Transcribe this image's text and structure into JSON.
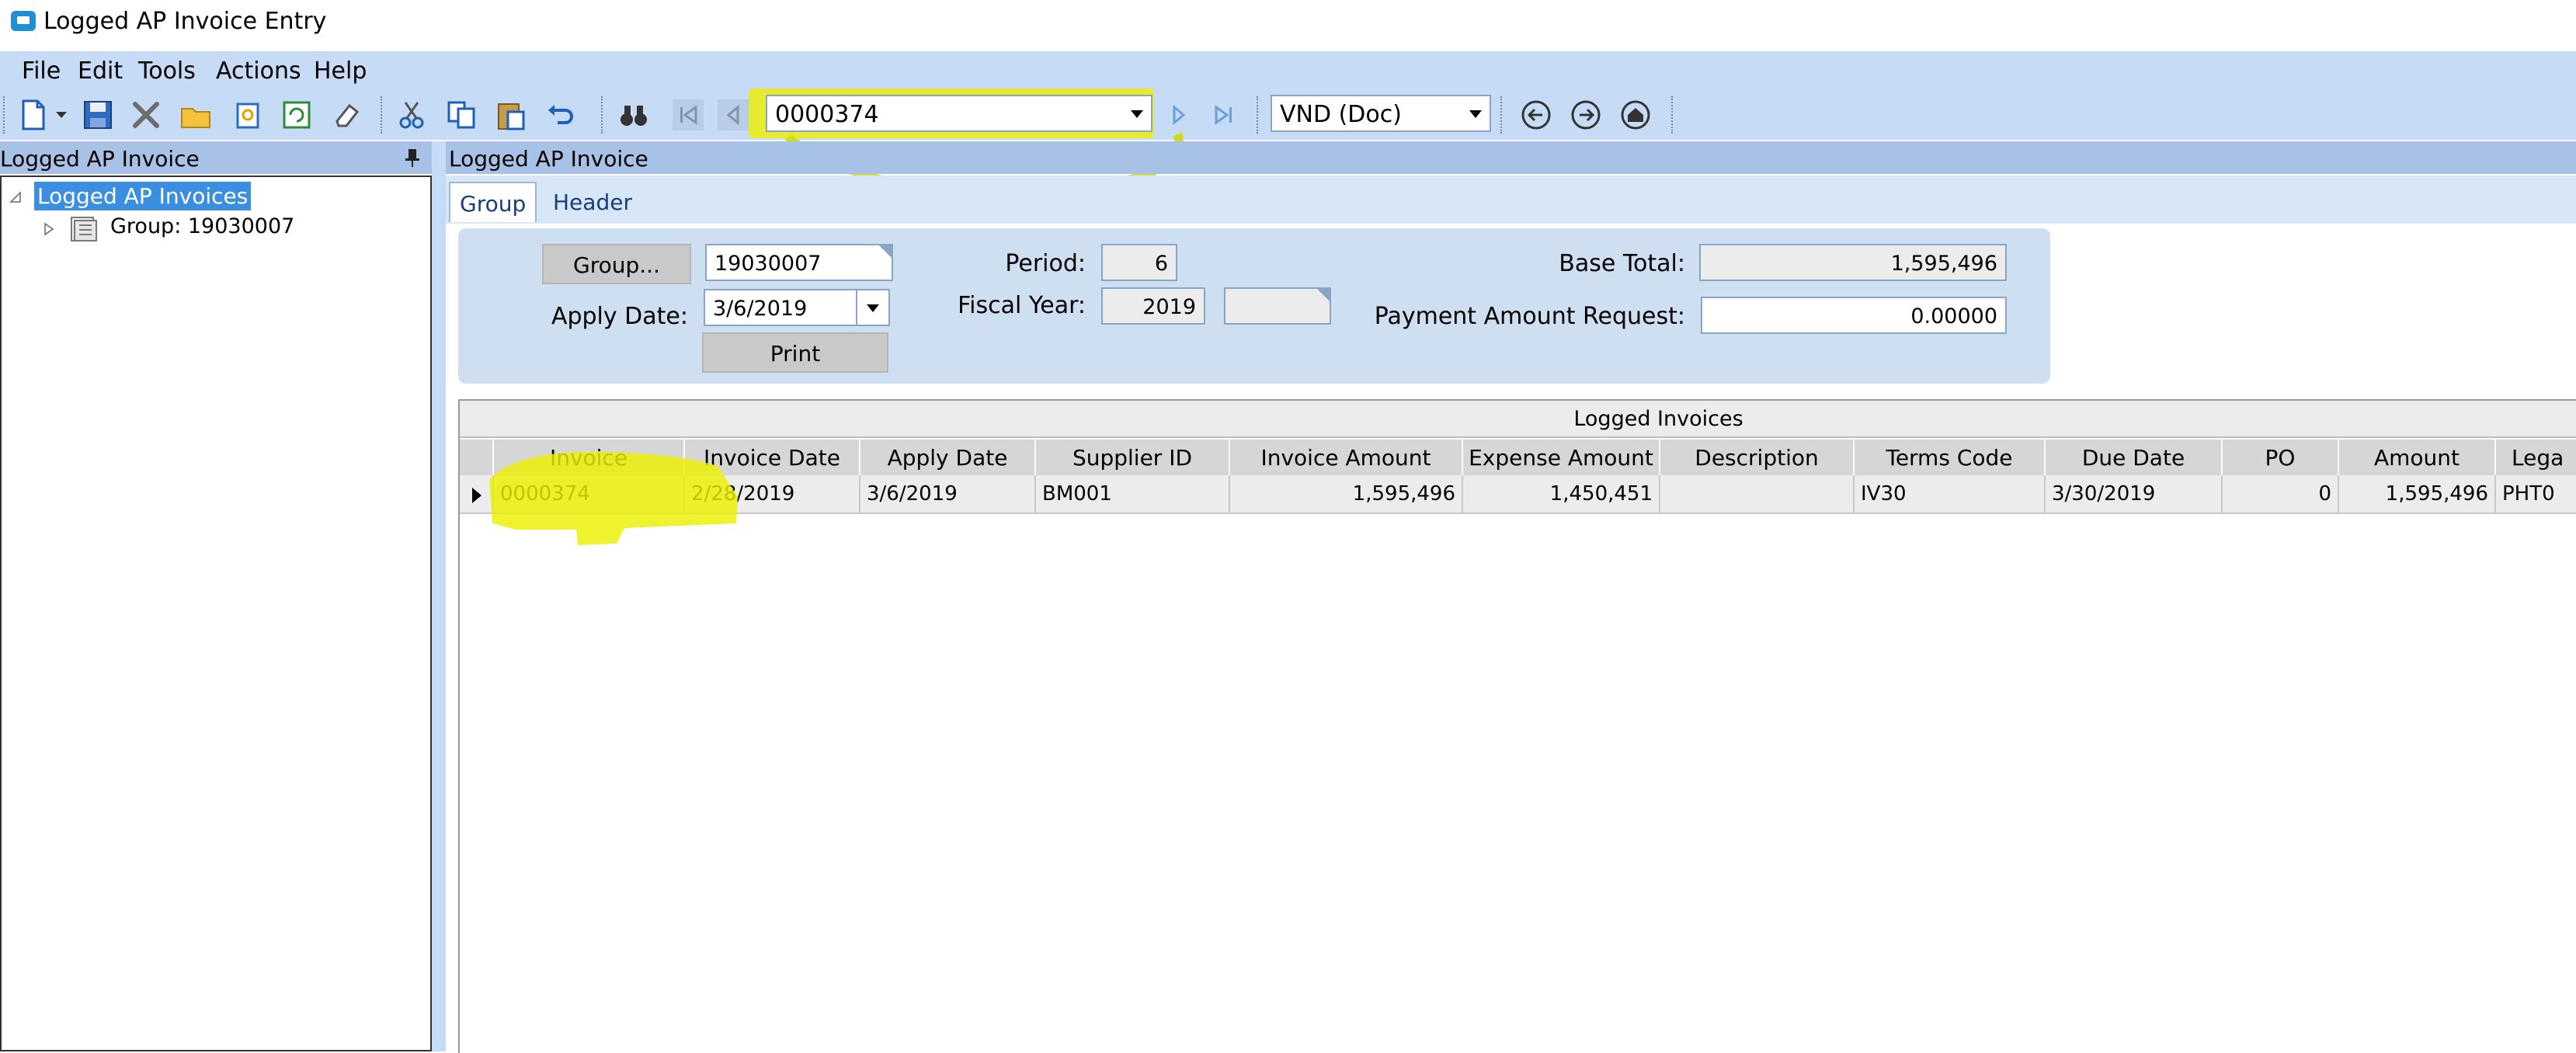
{
  "window": {
    "title": "Logged AP Invoice Entry"
  },
  "menu": {
    "file": "File",
    "edit": "Edit",
    "tools": "Tools",
    "actions": "Actions",
    "help": "Help"
  },
  "toolbar": {
    "record_value": "0000374",
    "currency_value": "VND (Doc)"
  },
  "left_panel": {
    "header": "Logged AP Invoice",
    "tree": {
      "root_label": "Logged AP Invoices",
      "child_label": "Group: 19030007"
    }
  },
  "right_panel": {
    "header": "Logged AP Invoice",
    "tabs": [
      {
        "label": "Group"
      },
      {
        "label": "Header"
      }
    ],
    "group": {
      "group_button": "Group...",
      "group_value": "19030007",
      "apply_date_label": "Apply Date:",
      "apply_date_value": "3/6/2019",
      "print_button": "Print",
      "period_label": "Period:",
      "period_value": "6",
      "fiscal_year_label": "Fiscal Year:",
      "fiscal_year_value": "2019",
      "fiscal_suffix_value": "",
      "base_total_label": "Base Total:",
      "base_total_value": "1,595,496",
      "payment_amount_label": "Payment Amount Request:",
      "payment_amount_value": "0.00000"
    },
    "grid": {
      "caption": "Logged Invoices",
      "columns": [
        "Invoice",
        "Invoice Date",
        "Apply Date",
        "Supplier ID",
        "Invoice Amount",
        "Expense Amount",
        "Description",
        "Terms Code",
        "Due Date",
        "PO",
        "Amount",
        "Lega"
      ],
      "rows": [
        [
          "0000374",
          "2/28/2019",
          "3/6/2019",
          "BM001",
          "1,595,496",
          "1,450,451",
          "",
          "IV30",
          "3/30/2019",
          "0",
          "1,595,496",
          "PHT0"
        ]
      ]
    }
  },
  "colors": {
    "chrome": "#c6dcf6",
    "panel_header": "#a7c2e6",
    "highlight": "#ecef00",
    "selection": "#3a8fe0"
  }
}
